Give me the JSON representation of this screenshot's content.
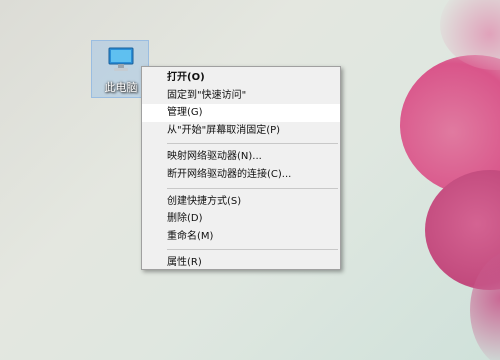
{
  "desktop": {
    "icon": {
      "label": "此电脑",
      "icon_name": "this-pc-icon"
    }
  },
  "context_menu": {
    "groups": [
      [
        {
          "label": "打开(O)",
          "bold": true
        },
        {
          "label": "固定到\"快速访问\""
        },
        {
          "label": "管理(G)",
          "highlighted": true
        },
        {
          "label": "从\"开始\"屏幕取消固定(P)"
        }
      ],
      [
        {
          "label": "映射网络驱动器(N)..."
        },
        {
          "label": "断开网络驱动器的连接(C)..."
        }
      ],
      [
        {
          "label": "创建快捷方式(S)"
        },
        {
          "label": "删除(D)"
        },
        {
          "label": "重命名(M)"
        }
      ],
      [
        {
          "label": "属性(R)"
        }
      ]
    ]
  },
  "colors": {
    "menu_bg": "#f0f0f0",
    "menu_highlight": "#ffffff",
    "icon_selection": "#96bee6"
  }
}
